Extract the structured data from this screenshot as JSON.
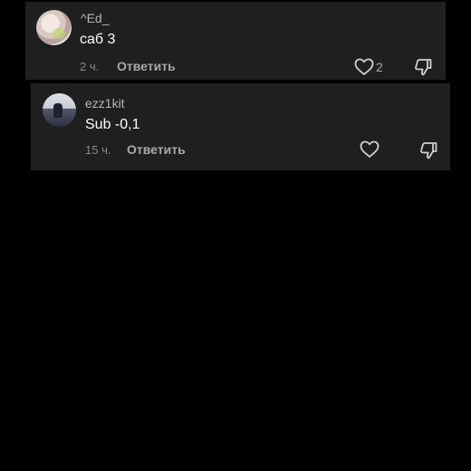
{
  "comments": [
    {
      "username": "^Ed_",
      "text": "саб 3",
      "time": "2 ч.",
      "reply_label": "Ответить",
      "like_count": "2",
      "avatar_icon": "user-avatar-icon"
    },
    {
      "username": "ezz1kit",
      "text": "Sub -0,1",
      "time": "15 ч.",
      "reply_label": "Ответить",
      "avatar_icon": "user-avatar-icon"
    }
  ],
  "icons": {
    "like": "heart-icon",
    "dislike": "thumbs-down-icon"
  },
  "colors": {
    "background": "#000000",
    "card": "#1f1f1f",
    "primary_text": "#ffffff",
    "secondary_text": "#8a8a8a"
  }
}
